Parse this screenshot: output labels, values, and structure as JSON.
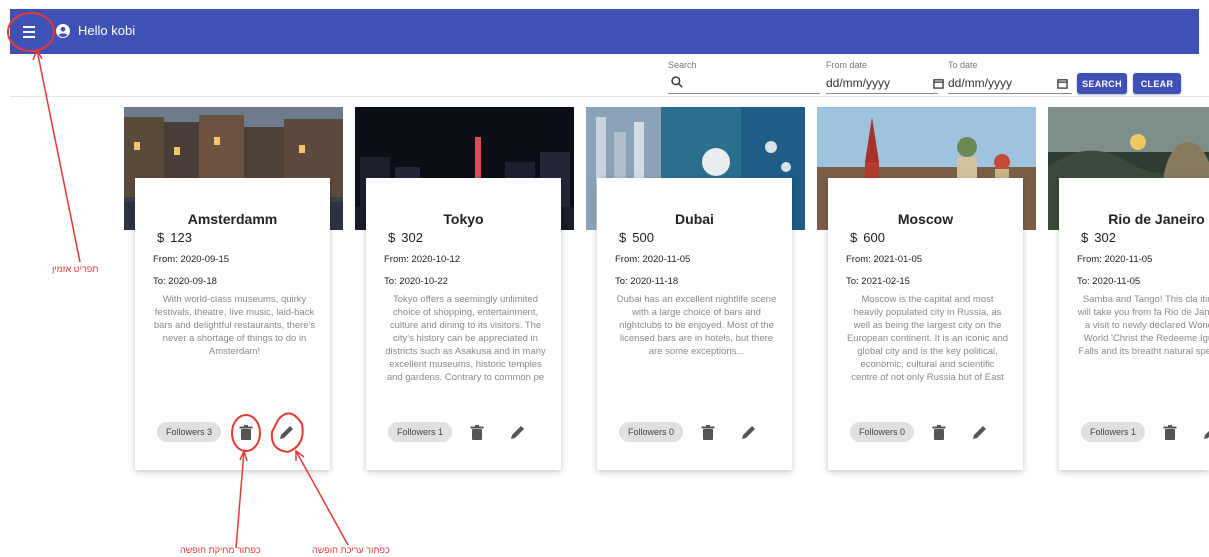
{
  "header": {
    "greeting": "Hello kobi"
  },
  "filters": {
    "search_label": "Search",
    "search_value": "",
    "from_label": "From date",
    "from_value": "dd/mm/yyyy",
    "to_label": "To date",
    "to_value": "dd/mm/yyyy",
    "search_button": "SEARCH",
    "clear_button": "CLEAR"
  },
  "cards": [
    {
      "title": "Amsterdamm",
      "price": "123",
      "from": "From: 2020-09-15",
      "to": "To: 2020-09-18",
      "description": "With world-class museums, quirky festivals, theatre, live music, laid-back bars and delightful restaurants, there's never a shortage of things to do in Amsterdam!",
      "followers": "Followers 3"
    },
    {
      "title": "Tokyo",
      "price": "302",
      "from": "From: 2020-10-12",
      "to": "To: 2020-10-22",
      "description": "Tokyo offers a seemingly unlimited choice of shopping, entertainment, culture and dining to its visitors. The city's history can be appreciated in districts such as Asakusa and in many excellent museums, historic temples and gardens. Contrary to common pe",
      "followers": "Followers 1"
    },
    {
      "title": "Dubai",
      "price": "500",
      "from": "From: 2020-11-05",
      "to": "To: 2020-11-18",
      "description": "Dubai has an excellent nightlife scene with a large choice of bars and nightclubs to be enjoyed. Most of the licensed bars are in hotels, but there are some exceptions...",
      "followers": "Followers 0"
    },
    {
      "title": "Moscow",
      "price": "600",
      "from": "From: 2021-01-05",
      "to": "To: 2021-02-15",
      "description": "Moscow is the capital and most heavily populated city in Russia, as well as being the largest city on the European continent. It is an iconic and global city and is the key political, economic, cultural and scientific centre of not only Russia but of East",
      "followers": "Followers 0"
    },
    {
      "title": "Rio de Janeiro",
      "price": "302",
      "from": "From: 2020-11-05",
      "to": "To: 2020-11-05",
      "description": "Samba and Tango! This cla itinerary will take you from fa Rio de Janeiro for a visit to newly declared Wonder of World 'Christ the Redeeme Iguassu Falls and its breatht natural spectacle.",
      "followers": "Followers 1"
    }
  ],
  "annotations": {
    "menu": "תפריט אזמין",
    "delete": "כפתור מחיקת חופשה",
    "edit": "כפתור עריכת חופשה"
  },
  "colors": {
    "appbar": "#3f51b5",
    "annotation": "#e53935"
  }
}
